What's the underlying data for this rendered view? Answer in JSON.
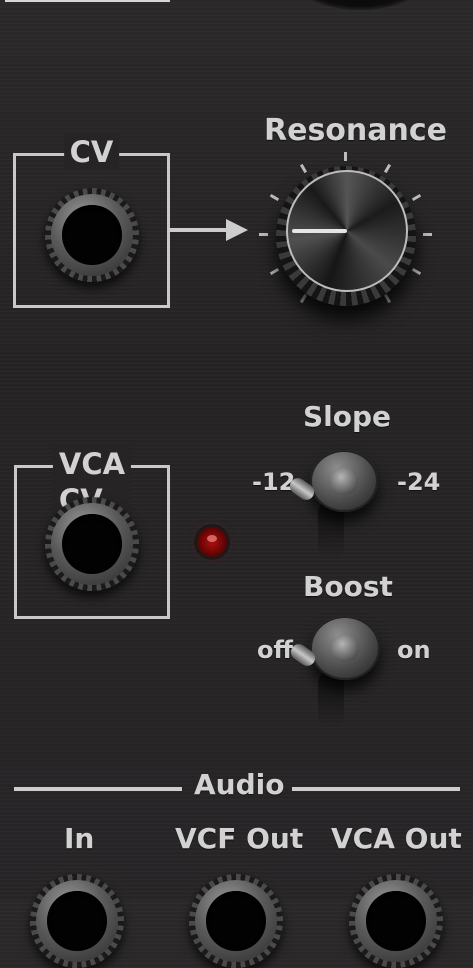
{
  "resonance": {
    "label": "Resonance"
  },
  "cv": {
    "label": "CV"
  },
  "slope": {
    "label": "Slope",
    "left": "-12",
    "right": "-24"
  },
  "boost": {
    "label": "Boost",
    "left": "off",
    "right": "on"
  },
  "vca_cv": {
    "label": "VCA CV"
  },
  "audio": {
    "section_label": "Audio",
    "outputs": [
      "In",
      "VCF Out",
      "VCA Out"
    ]
  },
  "colors": {
    "panel": "#262425",
    "text": "#d2d2d2",
    "led": "#b01010"
  }
}
